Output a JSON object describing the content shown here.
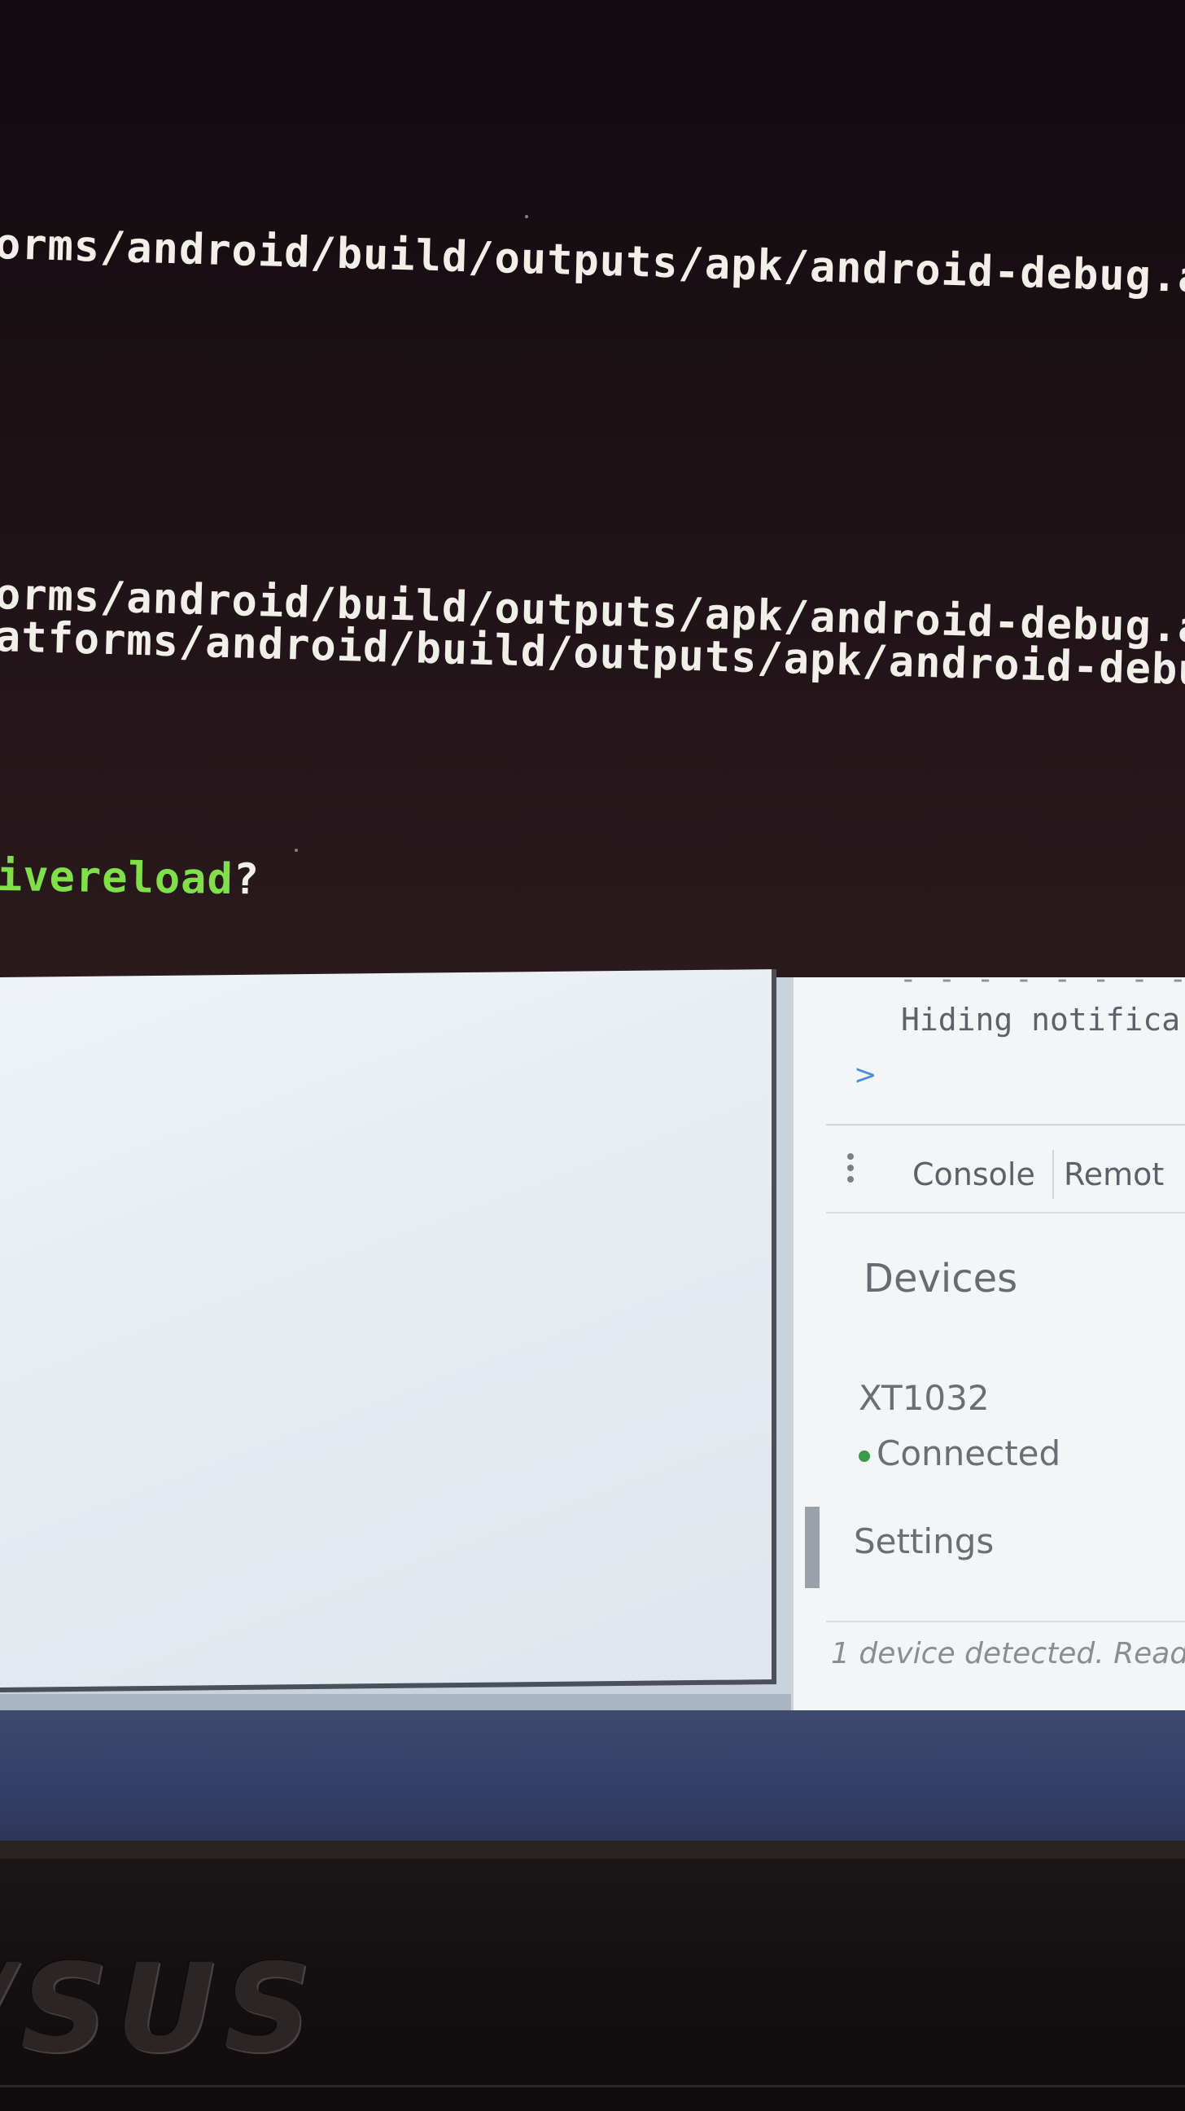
{
  "terminal": {
    "lines": [
      "orms/android/build/outputs/apk/android-debug.a",
      "orms/android/build/outputs/apk/android-debug.a",
      "atforms/android/build/outputs/apk/android-debu"
    ],
    "prompt": "ivereload",
    "prompt_suffix": "?",
    "colors": {
      "text": "#f2eee8",
      "prompt": "#7fe04a",
      "background": "#1a1014"
    }
  },
  "devtools": {
    "console_message": "Hiding notifica",
    "console_prompt": ">",
    "tabs": [
      "Console",
      "Remot"
    ],
    "menu_icon": "kebab-menu-icon",
    "heading": "Devices",
    "device": {
      "name": "XT1032",
      "status": "Connected",
      "status_color": "#3a9c47"
    },
    "settings_label": "Settings",
    "footer": "1 device detected. Read"
  },
  "laptop": {
    "logo": "/SUS"
  }
}
